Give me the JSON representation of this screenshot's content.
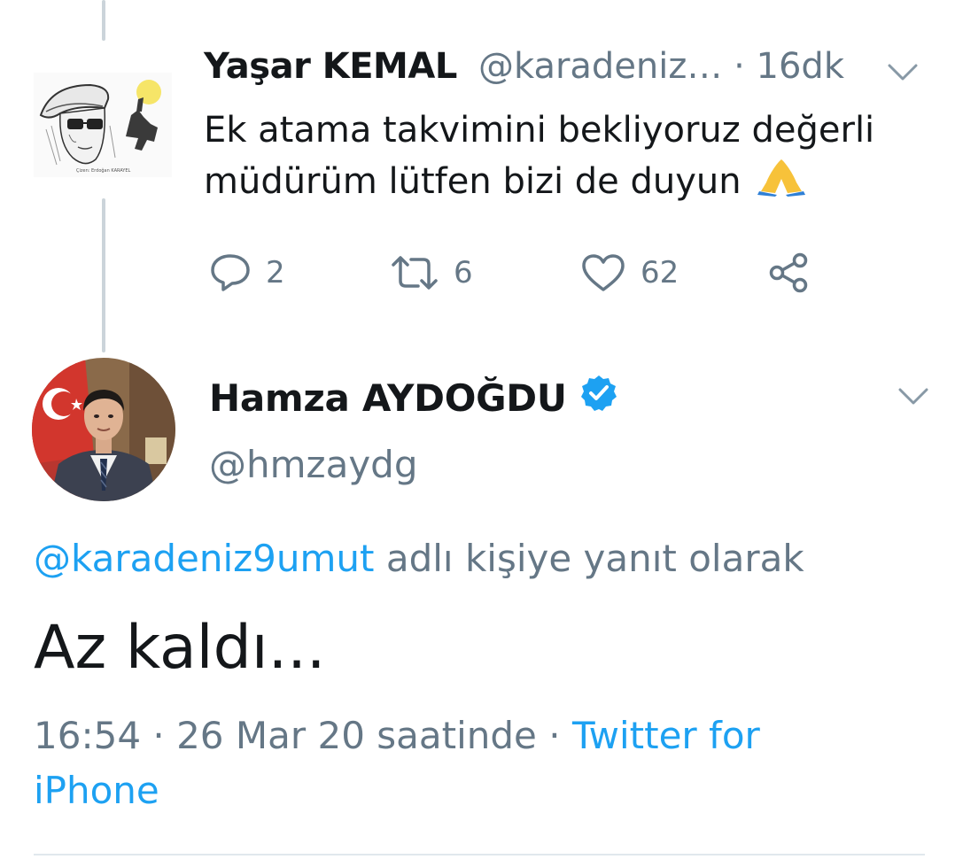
{
  "parent_tweet": {
    "display_name": "Yaşar KEMAL",
    "handle_time": "@karadeniz… · 16dk",
    "text": "Ek atama takvimini bekliyoruz değerli müdürüm lütfen bizi de duyun",
    "emoji": "🙏",
    "avatar_caption": "Çizen: Erdoğan KARAYEL",
    "replies": "2",
    "retweets": "6",
    "likes": "62"
  },
  "main_tweet": {
    "display_name": "Hamza AYDOĞDU",
    "handle": "@hmzaydg",
    "reply_mention": "@karadeniz9umut",
    "reply_suffix": " adlı kişiye yanıt olarak",
    "text": "Az kaldı...",
    "timestamp": "16:54 · 26 Mar 20 saatinde · ",
    "source": "Twitter for iPhone"
  },
  "colors": {
    "accent": "#1da1f2",
    "secondary_text": "#657786",
    "primary_text": "#14171a",
    "thread_line": "#cbd4da"
  },
  "icons": {
    "reply": "reply-icon",
    "retweet": "retweet-icon",
    "like": "heart-icon",
    "share": "share-icon",
    "menu": "chevron-down-icon",
    "verified": "verified-badge-icon"
  }
}
